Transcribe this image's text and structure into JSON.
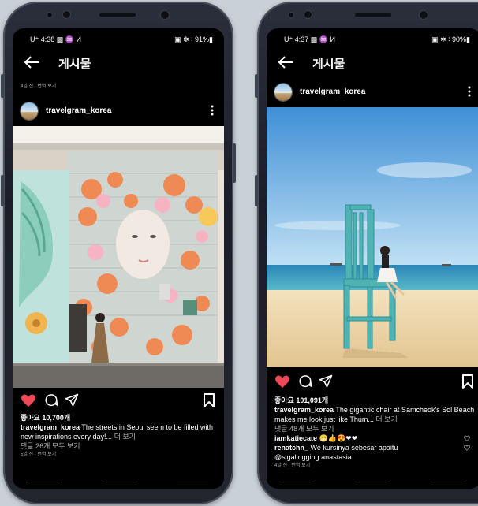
{
  "left": {
    "status": {
      "time": "U⁺ 4:38 ▩ ♒ И",
      "icons": "▣ ✲ ∶ 91%▮"
    },
    "page_title": "게시물",
    "meta_top": "4일 전 · 번역 보기",
    "username": "travelgram_korea",
    "likes": "좋아요 10,700개",
    "caption_user": "travelgram_korea",
    "caption_text": "The streets in Seoul seem to be filled with new inspirations every day!...",
    "caption_more": "더 보기",
    "comments_link": "댓글 26개 모두 보기",
    "date": "5일 전 · 번역 보기"
  },
  "right": {
    "status": {
      "time": "U⁺ 4:37 ▩ ♒ И",
      "icons": "▣ ✲ ∶ 90%▮"
    },
    "page_title": "게시물",
    "username": "travelgram_korea",
    "likes": "좋아요 101,091개",
    "caption_user": "travelgram_korea",
    "caption_text": "The gigantic chair at Samcheok's Sol Beach makes me look just like Thum...",
    "caption_more": "더 보기",
    "comments_link": "댓글 48개 모두 보기",
    "comment1_user": "iamkatiecate",
    "comment1_text": "😁👍😍❤❤",
    "comment2_user": "renatchn_",
    "comment2_text": "We kursinya sebesar apaitu @sigalingging.anastasia",
    "date": "4일 전 · 번역 보기"
  },
  "colors": {
    "heart": "#ed4956",
    "background": "#000000",
    "text": "#ffffff",
    "muted": "#b0b0b0"
  },
  "icons": [
    "back-arrow-icon",
    "more-options-icon",
    "heart-icon",
    "comment-icon",
    "share-icon",
    "bookmark-icon"
  ]
}
